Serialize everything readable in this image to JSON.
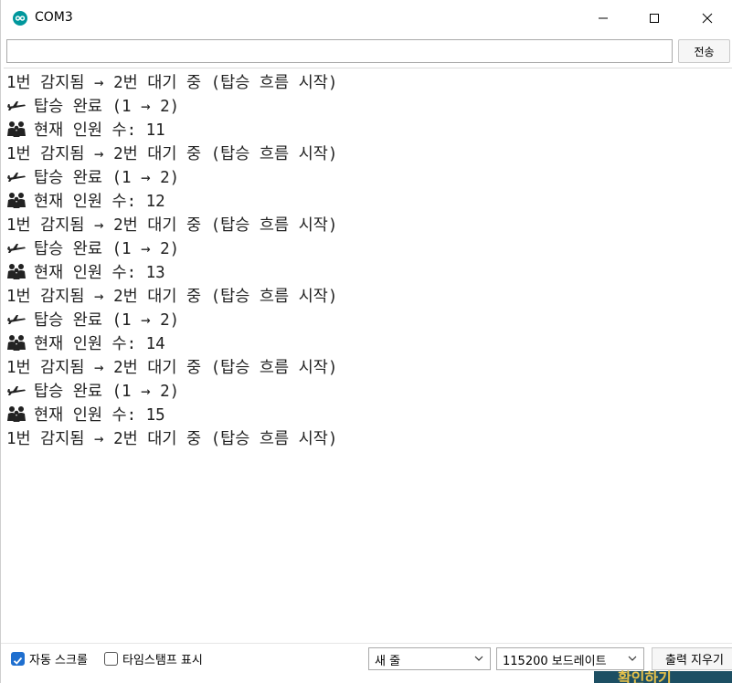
{
  "window": {
    "title": "COM3"
  },
  "send": {
    "input_value": "",
    "button_label": "전송"
  },
  "output": {
    "lines": [
      {
        "icon": "",
        "text": "1번 감지됨 → 2번 대기 중 (탑승 흐름 시작)"
      },
      {
        "icon": "airplane-icon",
        "text": "탑승 완료 (1 → 2)"
      },
      {
        "icon": "people-icon",
        "text": "현재 인원 수: 11"
      },
      {
        "icon": "",
        "text": "1번 감지됨 → 2번 대기 중 (탑승 흐름 시작)"
      },
      {
        "icon": "airplane-icon",
        "text": "탑승 완료 (1 → 2)"
      },
      {
        "icon": "people-icon",
        "text": "현재 인원 수: 12"
      },
      {
        "icon": "",
        "text": "1번 감지됨 → 2번 대기 중 (탑승 흐름 시작)"
      },
      {
        "icon": "airplane-icon",
        "text": "탑승 완료 (1 → 2)"
      },
      {
        "icon": "people-icon",
        "text": "현재 인원 수: 13"
      },
      {
        "icon": "",
        "text": "1번 감지됨 → 2번 대기 중 (탑승 흐름 시작)"
      },
      {
        "icon": "airplane-icon",
        "text": "탑승 완료 (1 → 2)"
      },
      {
        "icon": "people-icon",
        "text": "현재 인원 수: 14"
      },
      {
        "icon": "",
        "text": "1번 감지됨 → 2번 대기 중 (탑승 흐름 시작)"
      },
      {
        "icon": "airplane-icon",
        "text": "탑승 완료 (1 → 2)"
      },
      {
        "icon": "people-icon",
        "text": "현재 인원 수: 15"
      },
      {
        "icon": "",
        "text": "1번 감지됨 → 2번 대기 중 (탑승 흐름 시작)"
      }
    ]
  },
  "footer": {
    "autoscroll_label": "자동 스크롤",
    "autoscroll_checked": true,
    "timestamp_label": "타임스탬프 표시",
    "timestamp_checked": false,
    "line_ending": "새 줄",
    "baud_rate": "115200 보드레이트",
    "clear_label": "출력 지우기"
  },
  "background": {
    "partial_text": "확인하기"
  },
  "colors": {
    "accent": "#1f6fcf",
    "app_icon": "#00979c"
  }
}
